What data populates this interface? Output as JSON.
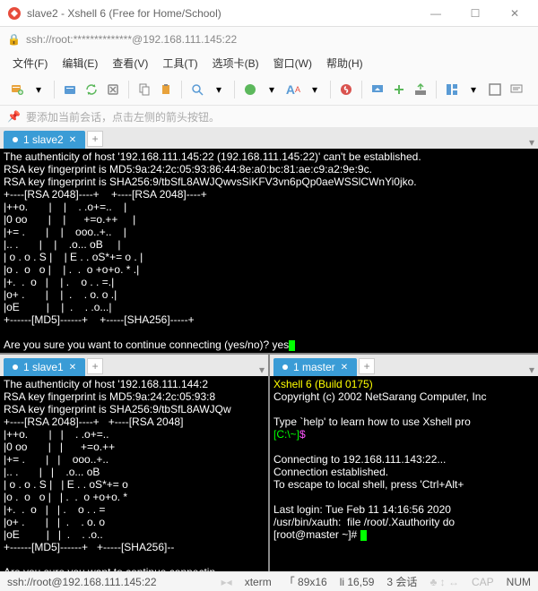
{
  "window": {
    "title": "slave2 - Xshell 6 (Free for Home/School)",
    "min": "—",
    "max": "☐",
    "close": "✕"
  },
  "address": "ssh://root:**************@192.168.111.145:22",
  "menu": {
    "file": "文件(F)",
    "edit": "编辑(E)",
    "view": "查看(V)",
    "tools": "工具(T)",
    "tabs": "选项卡(B)",
    "window": "窗口(W)",
    "help": "帮助(H)"
  },
  "hint": "要添加当前会话，点击左侧的箭头按钮。",
  "tabs": {
    "slave2": "1 slave2",
    "slave1": "1 slave1",
    "master": "1 master",
    "plus": "+"
  },
  "term_slave2": {
    "l1": "The authenticity of host '192.168.111.145:22 (192.168.111.145:22)' can't be established.",
    "l2": "RSA key fingerprint is MD5:9a:24:2c:05:93:86:44:8e:a0:bc:81:ae:c9:a2:9e:9c.",
    "l3": "RSA key fingerprint is SHA256:9/tbSfL8AWJQwvsSiKFV3vn6pQp0aeWSSlCWnYi0jko.",
    "l4": "+----[RSA 2048]----+    +----[RSA 2048]----+",
    "l5": "|++o.       |    |    . .o+=..    |",
    "l6": "|0 oo       |    |      +=o.++     |",
    "l7": "|+= .       |    |    ooo..+..    |",
    "l8": "|.. .       |    |    .o... oB     |",
    "l9": "| o . o . S |    | E . . oS*+= o . |",
    "l10": "|o .  o   o |    | .  .  o +o+o. * .|",
    "l11": "|+.  .  o   |    | .    o . . =.|",
    "l12": "|o+ .       |    |  .    . o. o .|",
    "l13": "|oE         |    |  .    . .o...|",
    "l14": "+------[MD5]------+    +-----[SHA256]-----+",
    "l15": "",
    "l16": "Are you sure you want to continue connecting (yes/no)? yes"
  },
  "term_slave1": {
    "l1": "The authenticity of host '192.168.111.144:2",
    "l2": "RSA key fingerprint is MD5:9a:24:2c:05:93:8",
    "l3": "RSA key fingerprint is SHA256:9/tbSfL8AWJQw",
    "l4": "+----[RSA 2048]----+   +----[RSA 2048]",
    "l5": "|++o.       |   |    . .o+=..",
    "l6": "|0 oo       |   |      +=o.++",
    "l7": "|+= .       |   |    ooo..+..",
    "l8": "|.. .       |   |    .o... oB",
    "l9": "| o . o . S |   | E . . oS*+= o",
    "l10": "|o .  o   o |   | .  .  o +o+o. *",
    "l11": "|+.  .  o   |   | .    o . . =",
    "l12": "|o+ .       |   |  .    . o. o",
    "l13": "|oE         |   |  .    . .o..",
    "l14": "+------[MD5]------+   +-----[SHA256]--",
    "l15": "",
    "l16": "Are you sure you want to continue connectin"
  },
  "term_master": {
    "l1": "Xshell 6 (Build 0175)",
    "l2": "Copyright (c) 2002 NetSarang Computer, Inc",
    "l3": "",
    "l4": "Type `help' to learn how to use Xshell pro",
    "l5a": "[C:\\~]",
    "l5b": "$",
    "l6": "",
    "l7": "Connecting to 192.168.111.143:22...",
    "l8": "Connection established.",
    "l9": "To escape to local shell, press 'Ctrl+Alt+",
    "l10": "",
    "l11": "Last login: Tue Feb 11 14:16:56 2020",
    "l12": "/usr/bin/xauth:  file /root/.Xauthority do",
    "l13": "[root@master ~]# "
  },
  "status": {
    "conn": "ssh://root@192.168.111.145:22",
    "term": "xterm",
    "size": "「 89x16",
    "pos": "li 16,59",
    "sess": "3 会话",
    "caps": "CAP",
    "num": "NUM"
  }
}
